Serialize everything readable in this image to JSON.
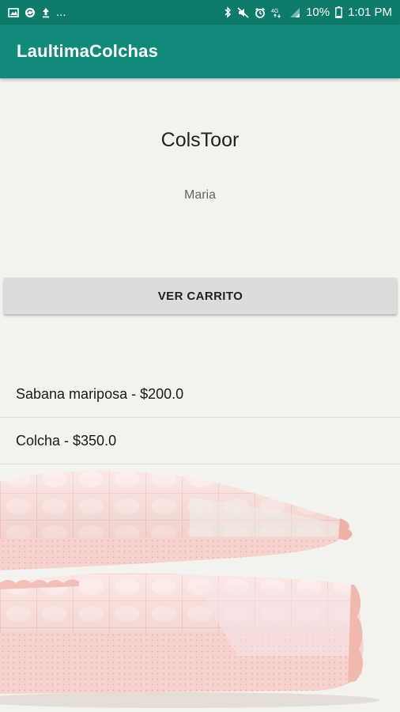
{
  "status_bar": {
    "dots": "...",
    "battery_pct": "10%",
    "time": "1:01 PM"
  },
  "app_bar": {
    "title": "LaultimaColchas"
  },
  "store": {
    "name": "ColsToor",
    "user": "Maria"
  },
  "cart_button": {
    "label": "VER CARRITO"
  },
  "products": [
    {
      "label": "Sabana mariposa - $200.0"
    },
    {
      "label": "Colcha - $350.0"
    }
  ],
  "colors": {
    "status_bar": "#0d7a6c",
    "app_bar": "#128a7a",
    "background": "#f4f2ee",
    "button": "#dcdcdc",
    "quilt": "#f4d0cc"
  },
  "icons": [
    "image-icon",
    "sync-icon",
    "upload-icon",
    "bluetooth-icon",
    "mute-icon",
    "alarm-icon",
    "lte-icon",
    "signal-icon",
    "battery-icon"
  ]
}
